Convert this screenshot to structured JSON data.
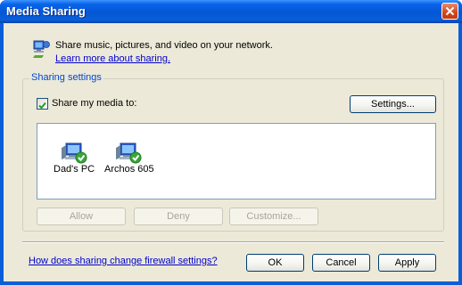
{
  "window": {
    "title": "Media Sharing"
  },
  "header": {
    "description": "Share music, pictures, and video on your network.",
    "learn_more": "Learn more about sharing."
  },
  "sharing_settings": {
    "group_label": "Sharing settings",
    "share_checkbox_label": "Share my media to:",
    "share_checked": true,
    "settings_button": "Settings...",
    "devices": [
      {
        "label": "Dad's PC",
        "icon": "network-computer-icon",
        "status": "allowed"
      },
      {
        "label": "Archos 605",
        "icon": "network-computer-icon",
        "status": "allowed"
      }
    ],
    "allow_button": "Allow",
    "deny_button": "Deny",
    "customize_button": "Customize..."
  },
  "footer": {
    "firewall_link": "How does sharing change firewall settings?",
    "ok_button": "OK",
    "cancel_button": "Cancel",
    "apply_button": "Apply"
  },
  "colors": {
    "titlebar": "#0a5fd8",
    "dialog_background": "#ece9d8",
    "link": "#0000cc",
    "check_badge": "#3aa63a"
  }
}
